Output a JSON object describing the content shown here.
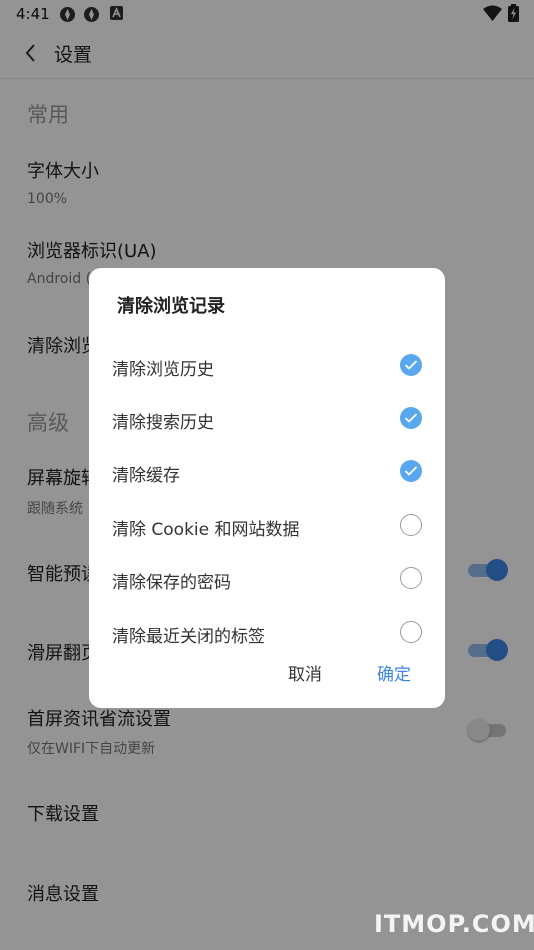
{
  "status_bar": {
    "time": "4:41"
  },
  "app_bar": {
    "title": "设置"
  },
  "settings": {
    "section_common": "常用",
    "font_size": {
      "title": "字体大小",
      "summary": "100%"
    },
    "user_agent": {
      "title": "浏览器标识(UA)",
      "summary": "Android ("
    },
    "clear_history": {
      "title": "清除浏览"
    },
    "section_advanced": "高级",
    "rotation": {
      "title": "屏幕旋转",
      "summary": "跟随系统"
    },
    "smart_preload": {
      "title": "智能预读",
      "enabled": true
    },
    "swipe_page": {
      "title": "滑屏翻页",
      "enabled": true
    },
    "data_saver": {
      "title": "首屏资讯省流设置",
      "summary": "仅在WIFI下自动更新",
      "enabled": false
    },
    "download": {
      "title": "下载设置"
    },
    "message": {
      "title": "消息设置"
    }
  },
  "dialog": {
    "title": "清除浏览记录",
    "options": [
      {
        "label": "清除浏览历史",
        "checked": true
      },
      {
        "label": "清除搜索历史",
        "checked": true
      },
      {
        "label": "清除缓存",
        "checked": true
      },
      {
        "label": "清除 Cookie 和网站数据",
        "checked": false
      },
      {
        "label": "清除保存的密码",
        "checked": false
      },
      {
        "label": "清除最近关闭的标签",
        "checked": false
      }
    ],
    "cancel_label": "取消",
    "confirm_label": "确定"
  },
  "watermark": "ITMOP.COM",
  "colors": {
    "accent": "#3d86e6",
    "check": "#58a7ef"
  }
}
